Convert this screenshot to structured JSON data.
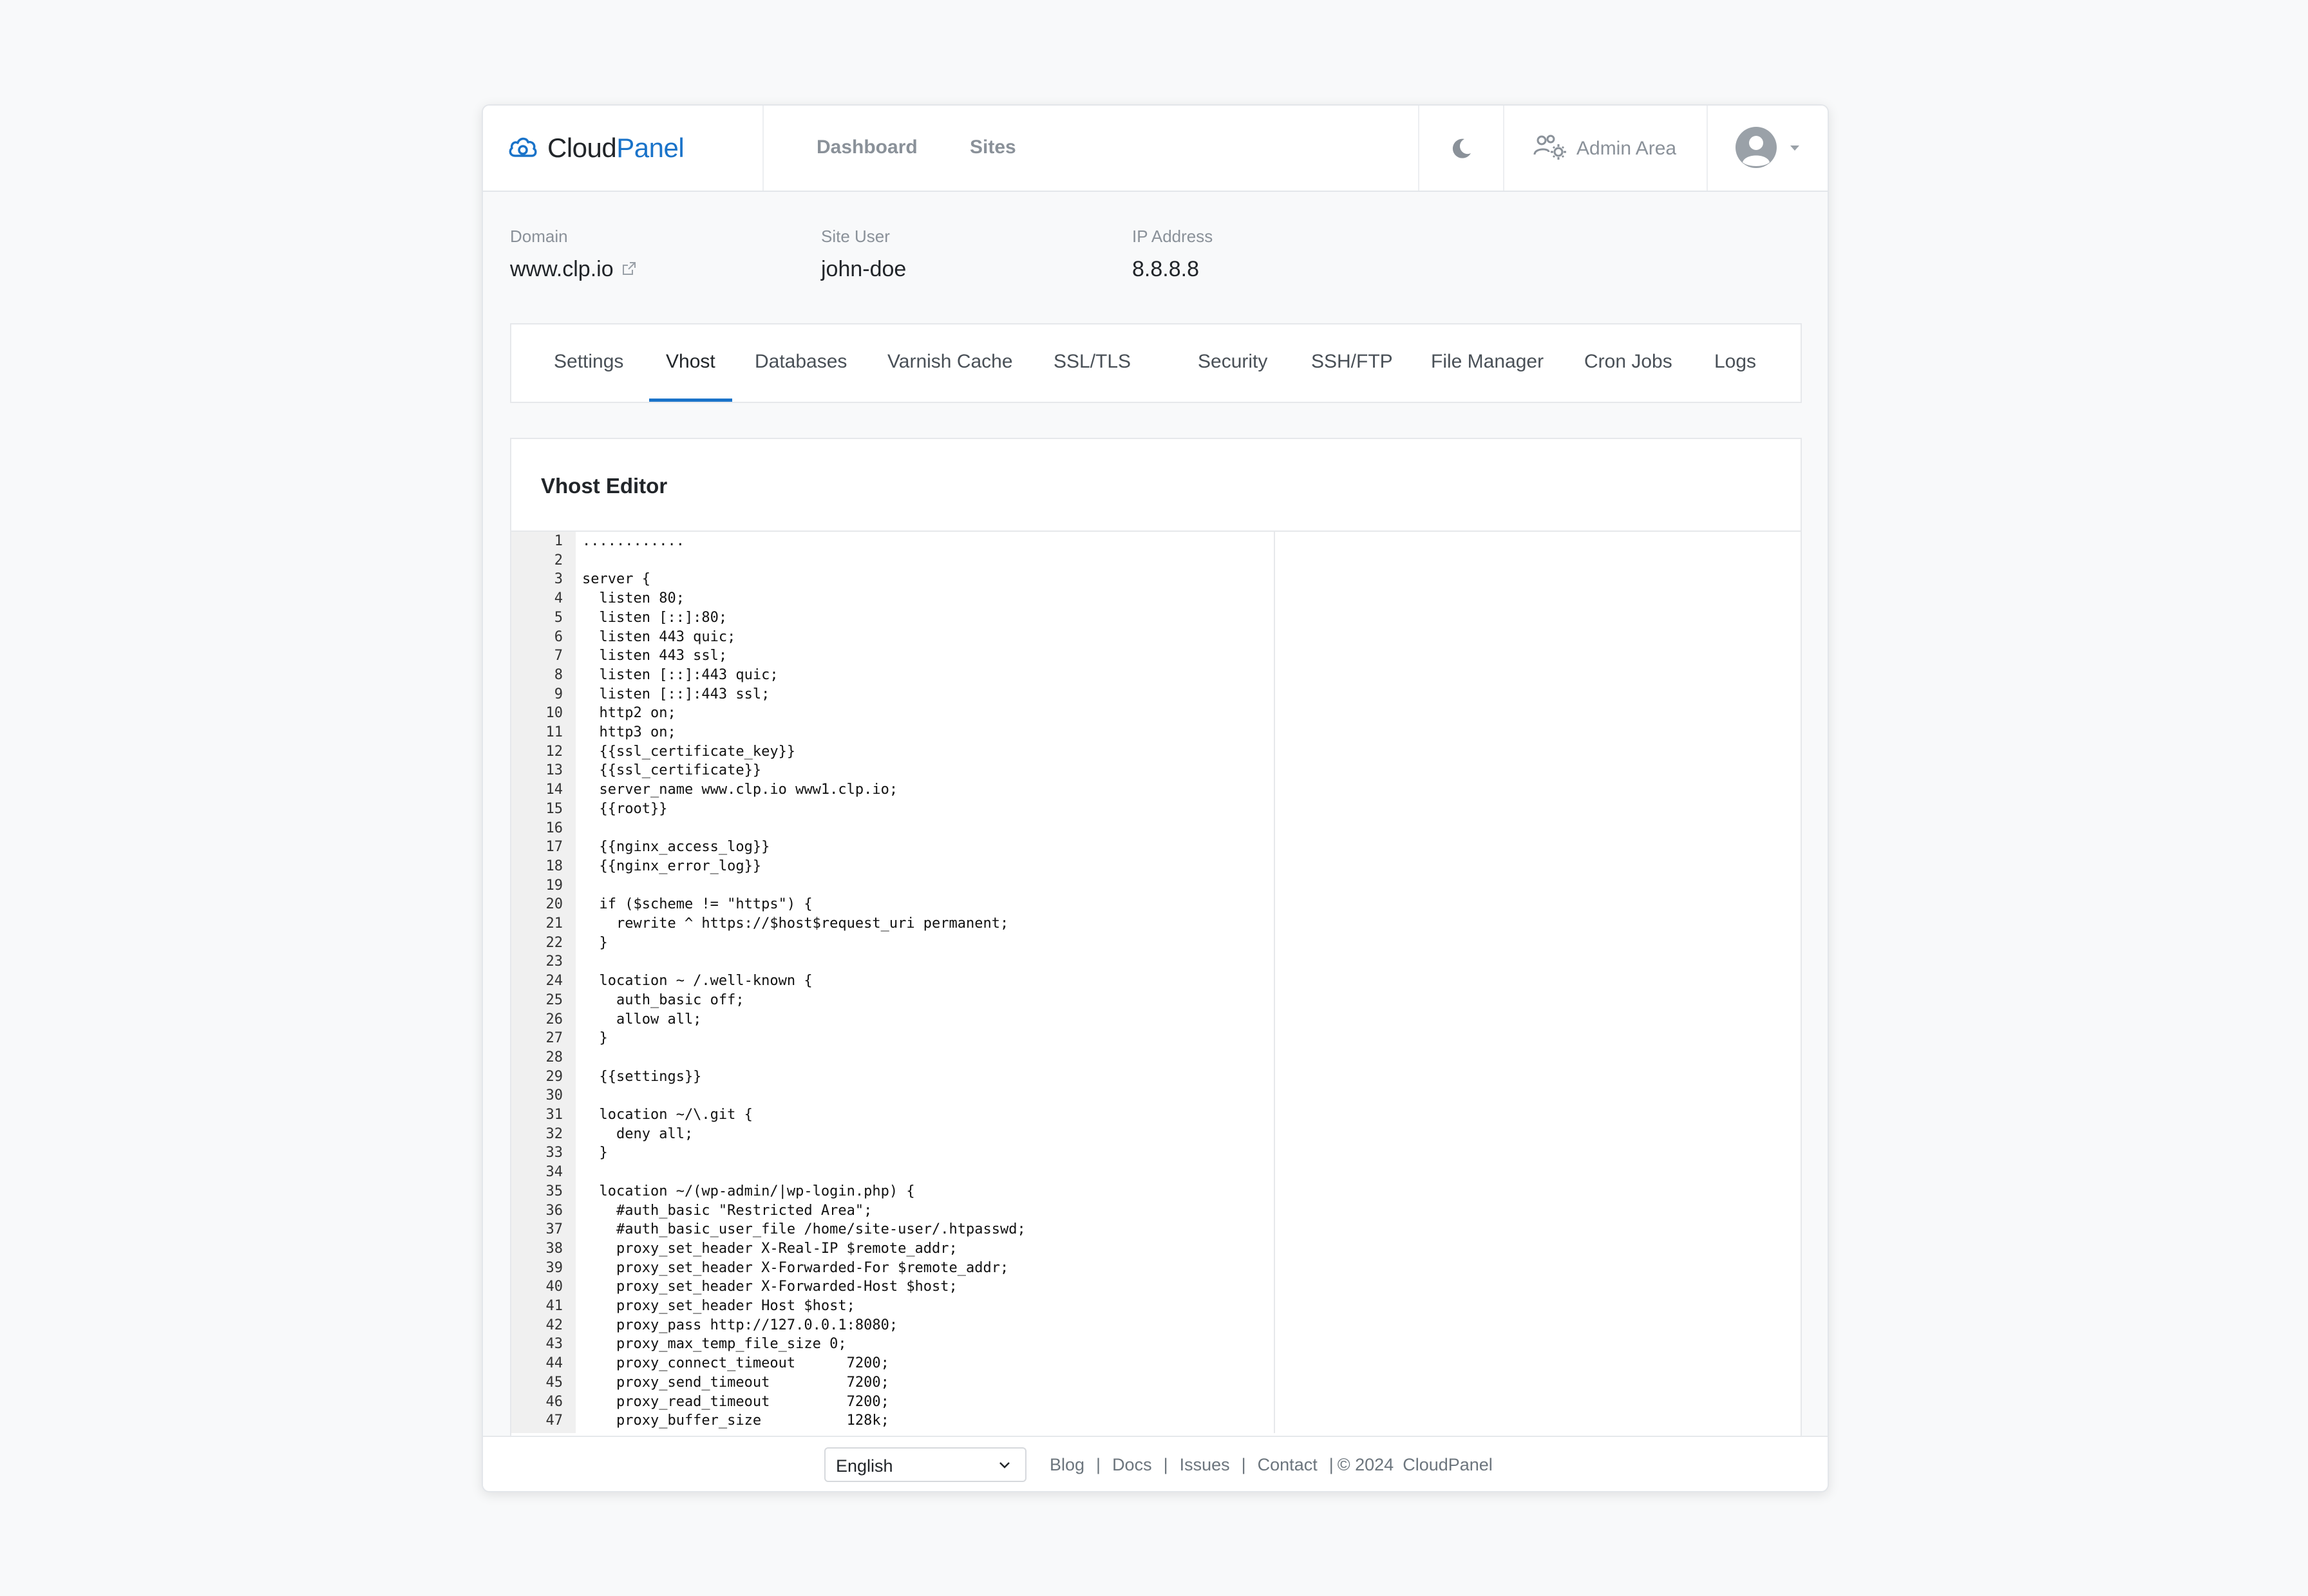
{
  "header": {
    "logo_part1": "Cloud",
    "logo_part2": "Panel",
    "nav": [
      "Dashboard",
      "Sites"
    ],
    "theme_toggle_icon": "moon-icon",
    "admin_area": "Admin Area",
    "brand_color": "#1a73c9"
  },
  "site_info": {
    "domain_label": "Domain",
    "domain_value": "www.clp.io",
    "user_label": "Site User",
    "user_value": "john-doe",
    "ip_label": "IP Address",
    "ip_value": "8.8.8.8"
  },
  "tabs": [
    "Settings",
    "Vhost",
    "Databases",
    "Varnish Cache",
    "SSL/TLS",
    "Security",
    "SSH/FTP",
    "File Manager",
    "Cron Jobs",
    "Logs"
  ],
  "active_tab": "Vhost",
  "editor": {
    "title": "Vhost Editor",
    "lines": [
      "............",
      "",
      "server {",
      "  listen 80;",
      "  listen [::]:80;",
      "  listen 443 quic;",
      "  listen 443 ssl;",
      "  listen [::]:443 quic;",
      "  listen [::]:443 ssl;",
      "  http2 on;",
      "  http3 on;",
      "  {{ssl_certificate_key}}",
      "  {{ssl_certificate}}",
      "  server_name www.clp.io www1.clp.io;",
      "  {{root}}",
      "",
      "  {{nginx_access_log}}",
      "  {{nginx_error_log}}",
      "",
      "  if ($scheme != \"https\") {",
      "    rewrite ^ https://$host$request_uri permanent;",
      "  }",
      "",
      "  location ~ /.well-known {",
      "    auth_basic off;",
      "    allow all;",
      "  }",
      "",
      "  {{settings}}",
      "",
      "  location ~/\\.git {",
      "    deny all;",
      "  }",
      "",
      "  location ~/(wp-admin/|wp-login.php) {",
      "    #auth_basic \"Restricted Area\";",
      "    #auth_basic_user_file /home/site-user/.htpasswd;",
      "    proxy_set_header X-Real-IP $remote_addr;",
      "    proxy_set_header X-Forwarded-For $remote_addr;",
      "    proxy_set_header X-Forwarded-Host $host;",
      "    proxy_set_header Host $host;",
      "    proxy_pass http://127.0.0.1:8080;",
      "    proxy_max_temp_file_size 0;",
      "    proxy_connect_timeout      7200;",
      "    proxy_send_timeout         7200;",
      "    proxy_read_timeout         7200;",
      "    proxy_buffer_size          128k;"
    ]
  },
  "footer": {
    "language": "English",
    "links": [
      "Blog",
      "Docs",
      "Issues",
      "Contact"
    ],
    "copyright": "© 2024",
    "brand": "CloudPanel"
  }
}
